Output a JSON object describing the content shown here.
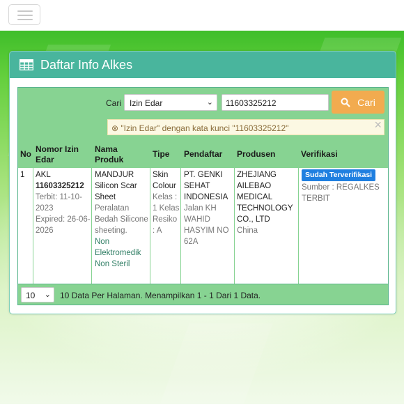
{
  "nav": {
    "menu_icon": "hamburger-icon"
  },
  "panel": {
    "title": "Daftar Info Alkes",
    "title_icon": "table-icon"
  },
  "search": {
    "label": "Cari",
    "filter_value": "Izin Edar",
    "query_value": "11603325212",
    "button_label": "Cari",
    "button_icon": "search-icon",
    "alert": "\"Izin Edar\" dengan kata kunci \"11603325212\"",
    "alert_icon": "clear-filter-icon"
  },
  "table": {
    "columns": [
      "No",
      "Nomor Izin Edar",
      "Nama Produk",
      "Tipe",
      "Pendaftar",
      "Produsen",
      "Verifikasi"
    ],
    "rows": [
      {
        "no": "1",
        "izin_prefix": "AKL",
        "izin_number": "11603325212",
        "terbit": "Terbit: 11-10-2023",
        "expired": "Expired: 26-06-2026",
        "nama": "MANDJUR Silicon Scar Sheet",
        "deskripsi": "Peralatan Bedah Silicone sheeting.",
        "kategori": "Non Elektromedik Non Steril",
        "tipe": "Skin Colour",
        "kelas": "Kelas : 1 Kelas Resiko : A",
        "pendaftar": "PT. GENKI SEHAT INDONESIA",
        "alamat": "Jalan KH WAHID HASYIM NO 62A",
        "produsen": "ZHEJIANG AILEBAO MEDICAL TECHNOLOGY CO., LTD",
        "negara": "China",
        "verifikasi": "Sudah Terverifikasi",
        "sumber": "Sumber : REGALKES TERBIT"
      }
    ]
  },
  "footer": {
    "per_page": "10",
    "info": "10 Data Per Halaman. Menampilkan 1 - 1 Dari 1 Data."
  },
  "colors": {
    "header": "#49b59d",
    "table_band": "#87d392",
    "button": "#f2ab4f",
    "badge": "#1f7fe0",
    "alert_bg": "#fcf8e3"
  }
}
